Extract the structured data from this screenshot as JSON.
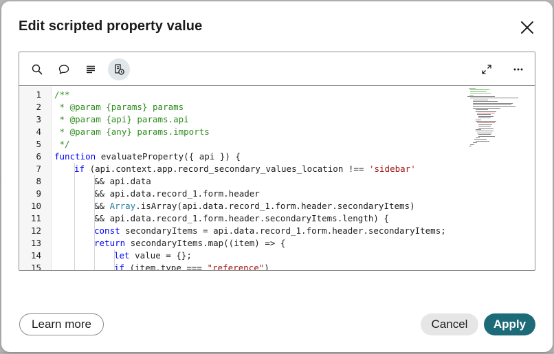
{
  "dialog": {
    "title": "Edit scripted property value",
    "close_icon": "close-icon"
  },
  "toolbar": {
    "left_tools": [
      {
        "name": "search-button",
        "icon": "search-icon"
      },
      {
        "name": "comment-button",
        "icon": "comment-icon"
      },
      {
        "name": "format-button",
        "icon": "format-lines-icon"
      },
      {
        "name": "script-includes-button",
        "icon": "script-badge-icon",
        "active": true
      }
    ],
    "right_tools": [
      {
        "name": "expand-button",
        "icon": "expand-icon"
      },
      {
        "name": "more-button",
        "icon": "more-horizontal-icon"
      }
    ]
  },
  "colors": {
    "comment": "#2e8b1e",
    "keyword": "#0000ff",
    "type": "#267f99",
    "string": "#a31515",
    "text": "#1e1e1e",
    "primary": "#1d6b78"
  },
  "code_lines": [
    {
      "num": "1",
      "indent": 0,
      "tokens": [
        {
          "t": "/**",
          "c": "comment"
        }
      ]
    },
    {
      "num": "2",
      "indent": 0,
      "tokens": [
        {
          "t": " * @param {params} params",
          "c": "comment"
        }
      ]
    },
    {
      "num": "3",
      "indent": 0,
      "tokens": [
        {
          "t": " * @param {api} params.api",
          "c": "comment"
        }
      ]
    },
    {
      "num": "4",
      "indent": 0,
      "tokens": [
        {
          "t": " * @param {any} params.imports",
          "c": "comment"
        }
      ]
    },
    {
      "num": "5",
      "indent": 0,
      "tokens": [
        {
          "t": " */",
          "c": "comment"
        }
      ]
    },
    {
      "num": "6",
      "indent": 0,
      "tokens": [
        {
          "t": "function",
          "c": "keyword"
        },
        {
          "t": " evaluateProperty({ api }) {",
          "c": "text"
        }
      ]
    },
    {
      "num": "7",
      "indent": 1,
      "tokens": [
        {
          "t": "if",
          "c": "keyword"
        },
        {
          "t": " (api.context.app.record_secondary_values_location !== ",
          "c": "text"
        },
        {
          "t": "'sidebar'",
          "c": "string"
        }
      ]
    },
    {
      "num": "8",
      "indent": 2,
      "tokens": [
        {
          "t": "&& api.data",
          "c": "text"
        }
      ]
    },
    {
      "num": "9",
      "indent": 2,
      "tokens": [
        {
          "t": "&& api.data.record_1.form.header",
          "c": "text"
        }
      ]
    },
    {
      "num": "10",
      "indent": 2,
      "tokens": [
        {
          "t": "&& ",
          "c": "text"
        },
        {
          "t": "Array",
          "c": "type"
        },
        {
          "t": ".isArray(api.data.record_1.form.header.secondaryItems)",
          "c": "text"
        }
      ]
    },
    {
      "num": "11",
      "indent": 2,
      "tokens": [
        {
          "t": "&& api.data.record_1.form.header.secondaryItems.length) {",
          "c": "text"
        }
      ]
    },
    {
      "num": "12",
      "indent": 2,
      "tokens": [
        {
          "t": "const",
          "c": "keyword"
        },
        {
          "t": " secondaryItems = api.data.record_1.form.header.secondaryItems;",
          "c": "text"
        }
      ]
    },
    {
      "num": "13",
      "indent": 2,
      "tokens": [
        {
          "t": "return",
          "c": "keyword"
        },
        {
          "t": " secondaryItems.map((item) => {",
          "c": "text"
        }
      ]
    },
    {
      "num": "14",
      "indent": 3,
      "tokens": [
        {
          "t": "let",
          "c": "keyword"
        },
        {
          "t": " value = {};",
          "c": "text"
        }
      ]
    },
    {
      "num": "15",
      "indent": 3,
      "tokens": [
        {
          "t": "if",
          "c": "keyword"
        },
        {
          "t": " (item.type === ",
          "c": "text"
        },
        {
          "t": "\"reference\"",
          "c": "string"
        },
        {
          "t": ")",
          "c": "text"
        }
      ]
    }
  ],
  "footer": {
    "learn_more_label": "Learn more",
    "cancel_label": "Cancel",
    "apply_label": "Apply"
  }
}
